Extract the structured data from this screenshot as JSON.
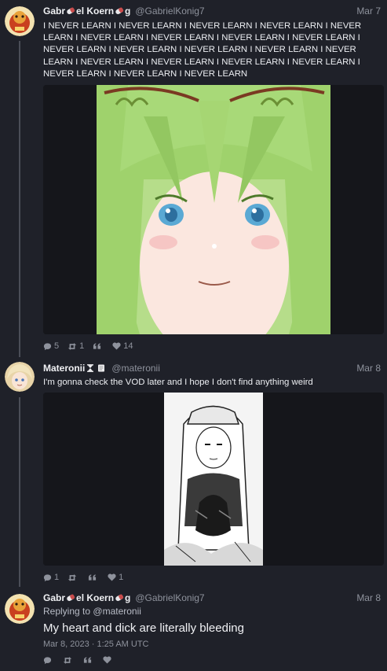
{
  "tweets": [
    {
      "display_name": "Gabr​el Koern​g",
      "name_part_1": "Gabr",
      "name_part_2": "el Koern",
      "name_part_3": "g",
      "handle": "@GabrielKonig7",
      "date": "Mar 7",
      "text": "I NEVER LEARN I NEVER LEARN I NEVER LEARN I NEVER LEARN I NEVER LEARN I NEVER LEARN I NEVER LEARN I NEVER LEARN I NEVER LEARN I NEVER LEARN I NEVER LEARN I NEVER LEARN I NEVER LEARN I NEVER LEARN I NEVER LEARN I NEVER LEARN I NEVER LEARN I NEVER LEARN I NEVER LEARN I NEVER LEARN I NEVER LEARN",
      "stats": {
        "replies": "5",
        "retweets": "1",
        "likes": "14"
      }
    },
    {
      "display_name": "Materonii",
      "handle": "@materonii",
      "date": "Mar 8",
      "text": "I'm gonna check the VOD later and I hope I don't find anything weird",
      "stats": {
        "replies": "1",
        "retweets": "",
        "likes": "1"
      }
    },
    {
      "name_part_1": "Gabr",
      "name_part_2": "el Koern",
      "name_part_3": "g",
      "handle": "@GabrielKonig7",
      "date": "Mar 8",
      "replying_to_label": "Replying to",
      "replying_to": "@materonii",
      "text": "My heart and dick are literally bleeding",
      "timestamp": "Mar 8, 2023 · 1:25 AM UTC"
    }
  ],
  "colors": {
    "background": "#1f2129",
    "muted": "#8e929c",
    "text": "#eceef2"
  }
}
